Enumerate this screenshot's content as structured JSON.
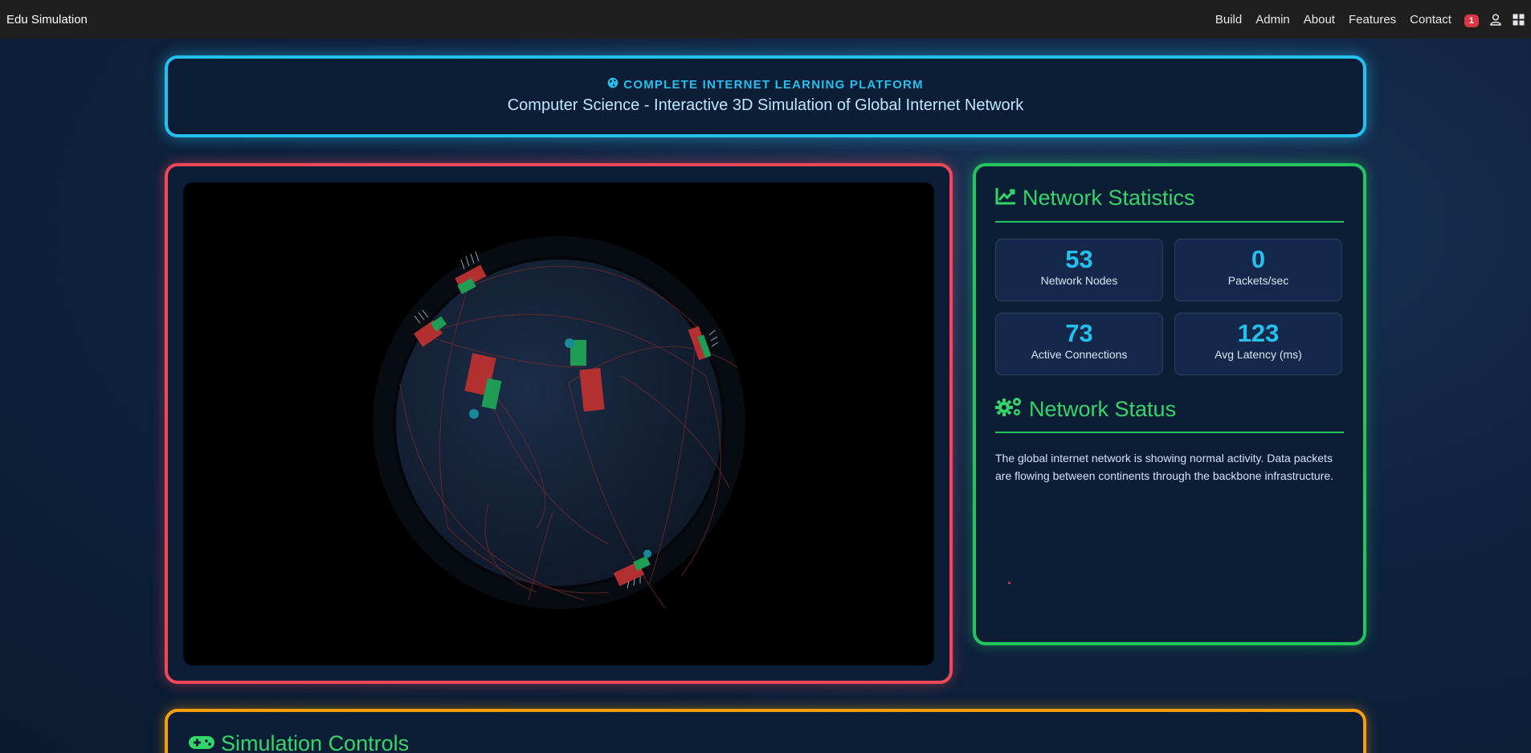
{
  "navbar": {
    "brand": "Edu Simulation",
    "links": [
      "Build",
      "Admin",
      "About",
      "Features",
      "Contact"
    ],
    "notification_count": "1",
    "icons": [
      "user-icon",
      "apps-grid-icon"
    ]
  },
  "header": {
    "tag": "COMPLETE INTERNET LEARNING PLATFORM",
    "tag_icon": "globe-icon",
    "title": "Computer Science - Interactive 3D Simulation of Global Internet Network"
  },
  "simulation": {
    "view": "3d-globe",
    "colors": {
      "router": "#c0392b",
      "server": "#1f9d55",
      "connection": "#8b2a2a"
    }
  },
  "statistics": {
    "title": "Network Statistics",
    "title_icon": "chart-line-icon",
    "items": [
      {
        "value": "53",
        "label": "Network Nodes"
      },
      {
        "value": "0",
        "label": "Packets/sec"
      },
      {
        "value": "73",
        "label": "Active Connections"
      },
      {
        "value": "123",
        "label": "Avg Latency (ms)"
      }
    ]
  },
  "status": {
    "title": "Network Status",
    "title_icon": "gears-icon",
    "text": "The global internet network is showing normal activity. Data packets are flowing between continents through the backbone infrastructure."
  },
  "controls": {
    "title": "Simulation Controls",
    "title_icon": "gamepad-icon"
  },
  "theme": {
    "header_border": "#22c1ee",
    "sim_border": "#f0475a",
    "stats_border": "#22c55e",
    "controls_border": "#f59e0b",
    "accent_value": "#22c1ee",
    "title_green": "#34d66a"
  }
}
